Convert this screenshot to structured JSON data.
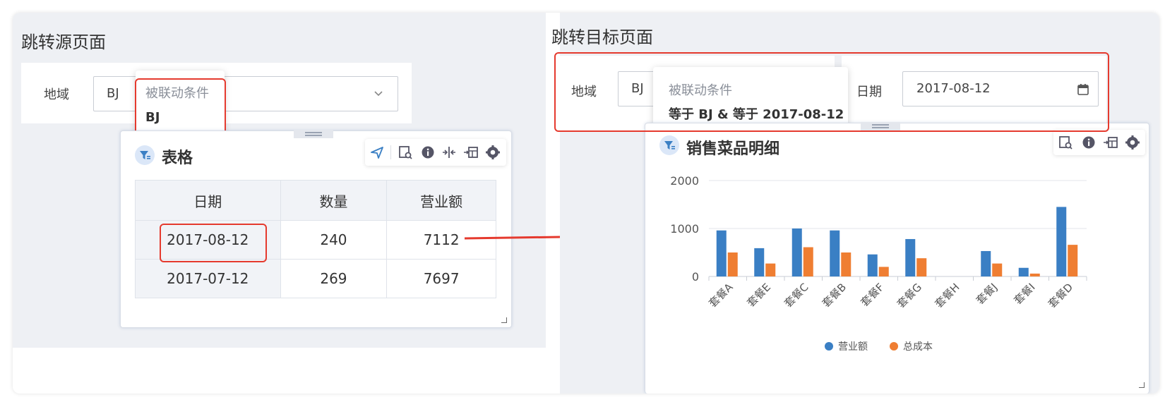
{
  "source_page": {
    "title": "跳转源页面",
    "region_filter": {
      "label": "地域",
      "value": "BJ"
    },
    "tooltip": {
      "title": "被联动条件",
      "value": "BJ"
    },
    "widget": {
      "title": "表格",
      "table": {
        "headers": [
          "日期",
          "数量",
          "营业额"
        ],
        "rows": [
          [
            "2017-08-12",
            "240",
            "7112"
          ],
          [
            "2017-07-12",
            "269",
            "7697"
          ]
        ]
      }
    }
  },
  "target_page": {
    "title": "跳转目标页面",
    "region_filter": {
      "label": "地域",
      "value": "BJ"
    },
    "date_filter": {
      "label": "日期",
      "value": "2017-08-12"
    },
    "tooltip": {
      "title": "被联动条件",
      "value": "等于 BJ & 等于 2017-08-12"
    },
    "widget": {
      "title": "销售菜品明细"
    }
  },
  "colors": {
    "accent": "#3a7fc4",
    "series_a": "#3a7fc4",
    "series_b": "#ef7e32",
    "highlight": "#e53a2e"
  },
  "chart_data": {
    "type": "bar",
    "categories": [
      "套餐A",
      "套餐E",
      "套餐C",
      "套餐B",
      "套餐F",
      "套餐G",
      "套餐H",
      "套餐J",
      "套餐I",
      "套餐D"
    ],
    "series": [
      {
        "name": "营业额",
        "values": [
          960,
          590,
          1000,
          960,
          460,
          780,
          0,
          530,
          180,
          1450
        ]
      },
      {
        "name": "总成本",
        "values": [
          500,
          270,
          610,
          500,
          200,
          380,
          0,
          270,
          60,
          660
        ]
      }
    ],
    "ylim": [
      0,
      2000
    ],
    "yticks": [
      "2000",
      "1000",
      "0"
    ],
    "grid": true,
    "legend": "bottom"
  }
}
